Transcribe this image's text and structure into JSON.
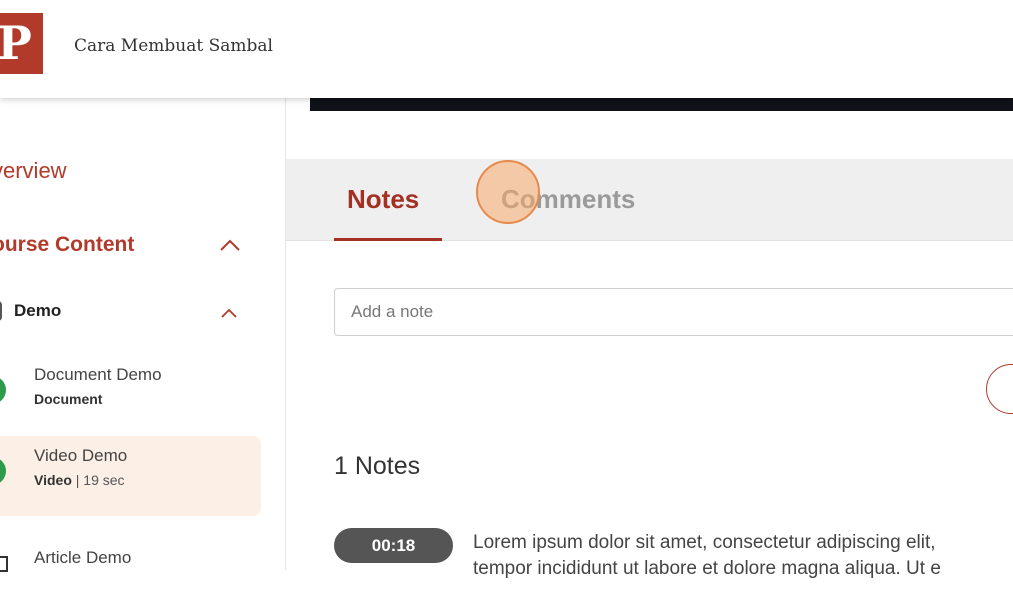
{
  "header": {
    "logo_letter": "P",
    "title": "Cara Membuat Sambal"
  },
  "sidebar": {
    "overview_label": "verview",
    "course_content_label": "ourse Content",
    "section": {
      "label": "Demo"
    },
    "lessons": [
      {
        "title": "Document Demo",
        "type": "Document",
        "duration": ""
      },
      {
        "title": "Video Demo",
        "type": "Video",
        "duration": " | 19 sec"
      },
      {
        "title": "Article Demo",
        "type": "",
        "duration": ""
      }
    ]
  },
  "tabs": {
    "notes_label": "Notes",
    "comments_label": "Comments"
  },
  "notes": {
    "input_placeholder": "Add a note",
    "count_label": "1 Notes",
    "items": [
      {
        "timestamp": "00:18",
        "text": "Lorem ipsum dolor sit amet, consectetur adipiscing elit,",
        "text_line2": "tempor incididunt ut labore et dolore magna aliqua. Ut e"
      }
    ]
  },
  "colors": {
    "accent": "#a23023",
    "brand": "#b23a2b",
    "complete": "#2e9a4b",
    "active_lesson_bg": "#fbefe6"
  }
}
